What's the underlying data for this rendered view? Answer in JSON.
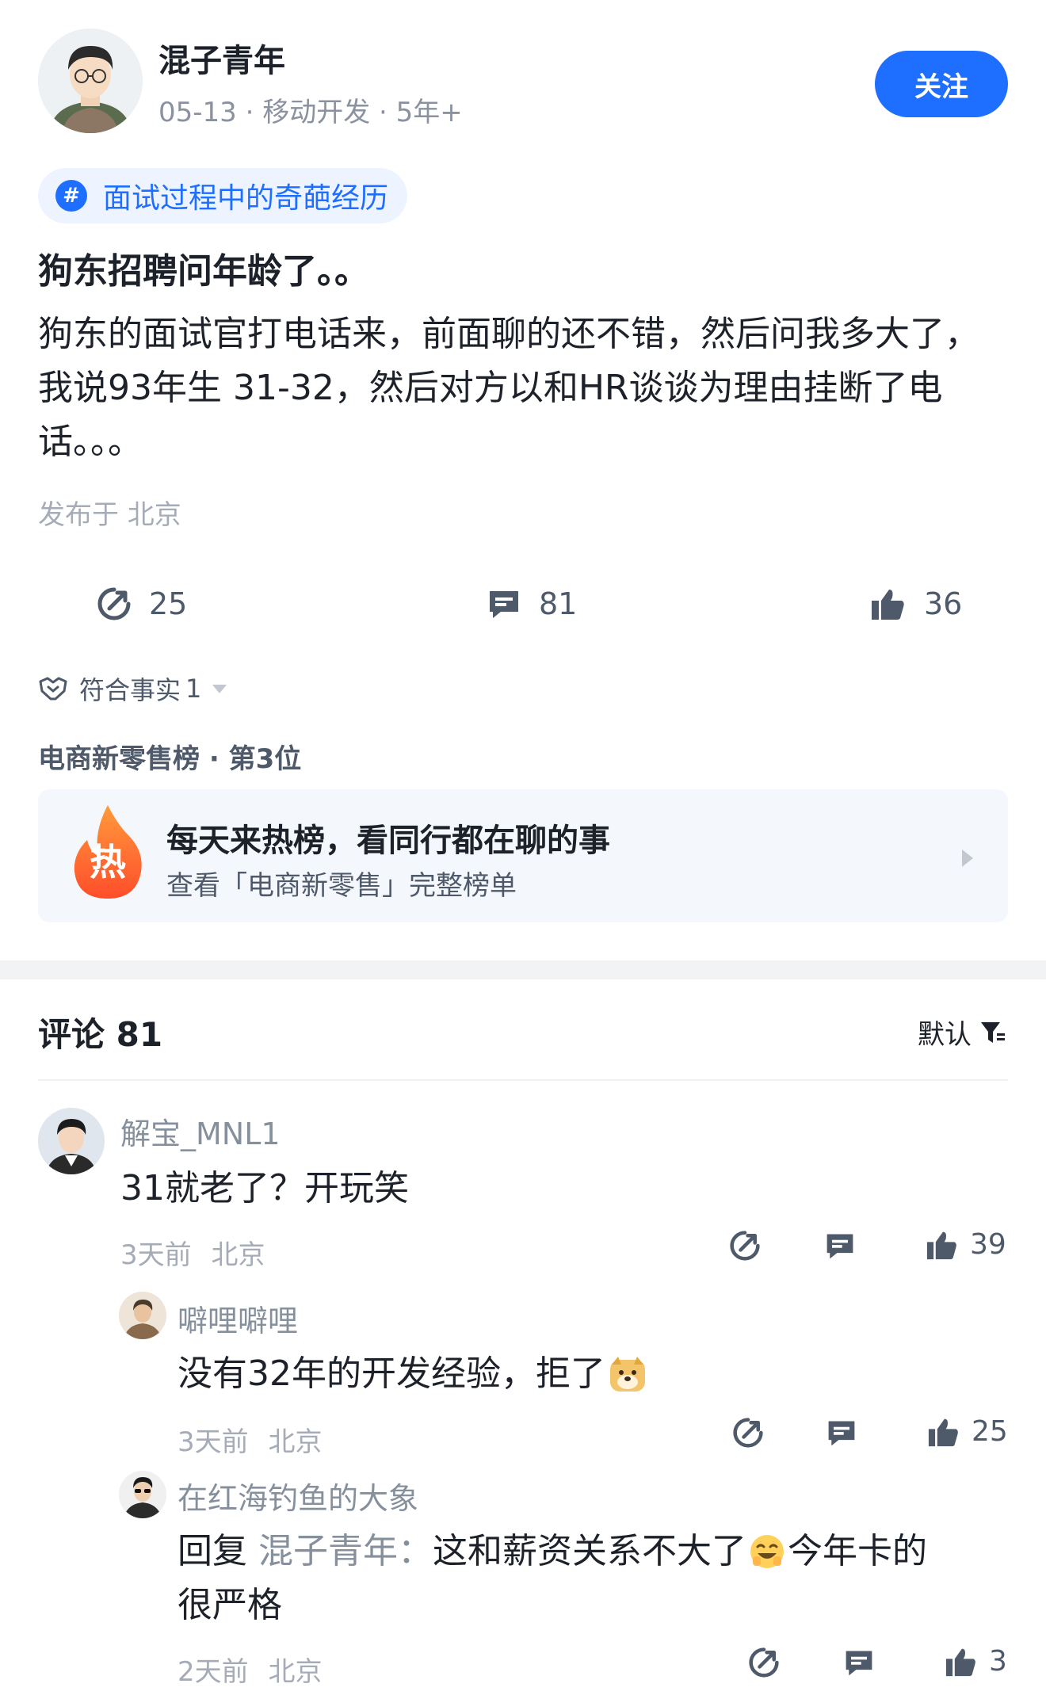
{
  "author": {
    "name": "混子青年",
    "meta": "05-13 · 移动开发 · 5年+",
    "follow_label": "关注"
  },
  "post": {
    "topic": "面试过程中的奇葩经历",
    "title": "狗东招聘问年龄了。。",
    "body": "狗东的面试官打电话来，前面聊的还不错，然后问我多大了，我说93年生 31-32，然后对方以和HR谈谈为理由挂断了电话。。。",
    "location": "发布于 北京"
  },
  "actions": {
    "share_count": "25",
    "comment_count": "81",
    "like_count": "36"
  },
  "fact": {
    "label": "符合事实",
    "count": "1"
  },
  "rank": {
    "label": "电商新零售榜 · 第3位",
    "hot_icon_text": "热",
    "card_title": "每天来热榜，看同行都在聊的事",
    "card_subtitle": "查看「电商新零售」完整榜单"
  },
  "comments_section": {
    "title": "评论 81",
    "sort_label": "默认"
  },
  "comments": [
    {
      "name": "解宝_MNL1",
      "text": "31就老了？开玩笑",
      "time": "3天前",
      "location": "北京",
      "likes": "39"
    },
    {
      "name": "噼哩噼哩",
      "text": "没有32年的开发经验，拒了",
      "time": "3天前",
      "location": "北京",
      "likes": "25"
    },
    {
      "name": "在红海钓鱼的大象",
      "reply_prefix": "回复",
      "reply_to": "混子青年：",
      "text": "这和薪资关系不大了",
      "text_after_emoji": "今年卡的",
      "text_line2": "很严格",
      "time": "2天前",
      "location": "北京",
      "likes": "3"
    }
  ],
  "colors": {
    "accent": "#1e6fff",
    "hot_orange": "#ff6a2a",
    "muted_text": "#8a919f"
  }
}
